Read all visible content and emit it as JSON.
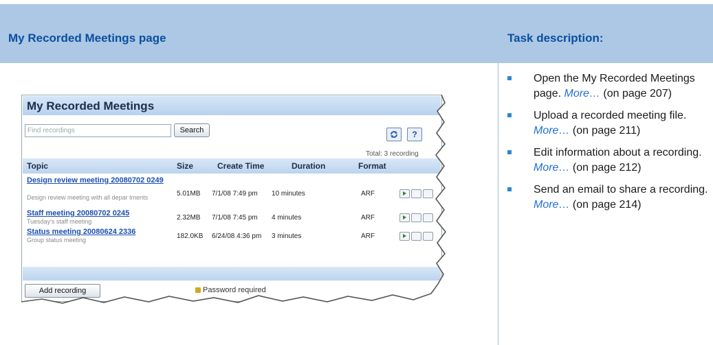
{
  "header": {
    "left_title": "My Recorded Meetings page",
    "right_title": "Task description:"
  },
  "tasks": [
    {
      "text": "Open the My Recorded Meetings page.",
      "link": "More…",
      "ref": "(on page 207)"
    },
    {
      "text": "Upload a recorded meeting file.",
      "link": "More…",
      "ref": "(on page 211)"
    },
    {
      "text": "Edit information about a recording.",
      "link": "More…",
      "ref": "(on page 212)"
    },
    {
      "text": "Send an email to share a recording.",
      "link": "More…",
      "ref": "(on page 214)"
    }
  ],
  "screenshot": {
    "title": "My Recorded Meetings",
    "search_placeholder": "Find recordings",
    "search_button": "Search",
    "help_label": "?",
    "total": "Total: 3 recording",
    "columns": {
      "topic": "Topic",
      "size": "Size",
      "create_time": "Create Time",
      "duration": "Duration",
      "format": "Format"
    },
    "rows": [
      {
        "topic": "Design review meeting 20080702 0249",
        "desc": "Design review meeting with all depar tments",
        "size": "5.01MB",
        "create_time": "7/1/08 7:49 pm",
        "duration": "10 minutes",
        "format": "ARF"
      },
      {
        "topic": "Staff meeting 20080702 0245",
        "desc": "Tuesday's staff meeting",
        "size": "2.32MB",
        "create_time": "7/1/08 7:45 pm",
        "duration": "4 minutes",
        "format": "ARF"
      },
      {
        "topic": "Status meeting 20080624 2336",
        "desc": "Group status meeting",
        "size": "182.0KB",
        "create_time": "6/24/08 4:36 pm",
        "duration": "3 minutes",
        "format": "ARF"
      }
    ],
    "add_button": "Add recording",
    "password_note": "Password required"
  }
}
